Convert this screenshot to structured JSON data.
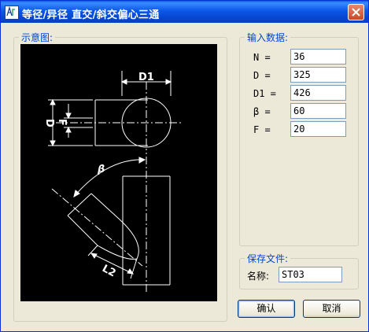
{
  "window": {
    "title": "等径/异径 直交/斜交偏心三通"
  },
  "preview_group": {
    "legend": "示意图:",
    "drawing_labels": {
      "d1": "D1",
      "d": "D",
      "f": "F",
      "beta": "β",
      "l2": "L2"
    }
  },
  "input_group": {
    "legend": "输入数据:",
    "fields": [
      {
        "label": "N =",
        "value": "36"
      },
      {
        "label": "D =",
        "value": "325"
      },
      {
        "label": "D1 =",
        "value": "426"
      },
      {
        "label": "β =",
        "value": "60"
      },
      {
        "label": "F =",
        "value": "20"
      }
    ]
  },
  "save_group": {
    "legend": "保存文件:",
    "name_label": "名称:",
    "name_value": "ST03"
  },
  "buttons": {
    "ok": "确认",
    "cancel": "取消"
  },
  "colors": {
    "titlebar": "#0a5fd8",
    "legend_text": "#0046d5",
    "drawing_background": "#000000",
    "drawing_lines": "#ffffff"
  }
}
